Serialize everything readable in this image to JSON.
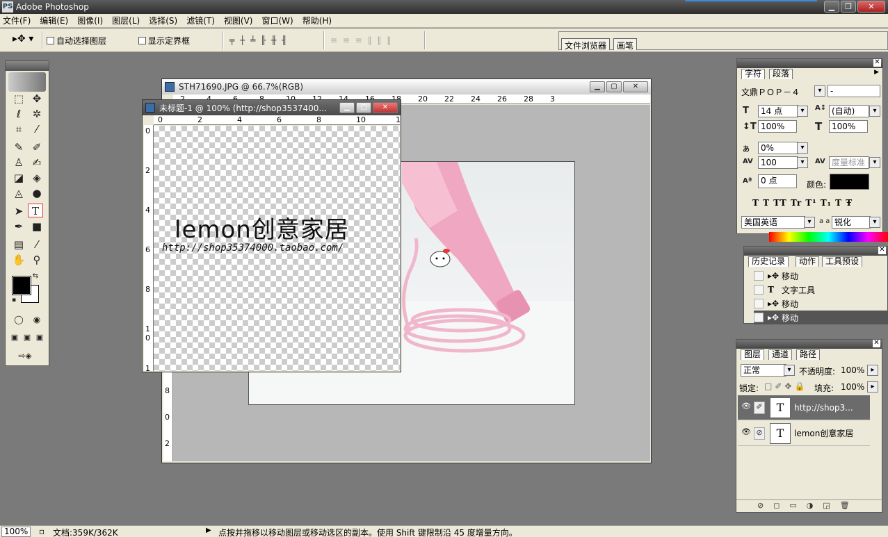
{
  "app": {
    "title": "Adobe Photoshop"
  },
  "menu": [
    "文件(F)",
    "编辑(E)",
    "图像(I)",
    "图层(L)",
    "选择(S)",
    "滤镜(T)",
    "视图(V)",
    "窗口(W)",
    "帮助(H)"
  ],
  "options": {
    "auto_select": "自动选择图层",
    "show_bounds": "显示定界框"
  },
  "well": {
    "tab1": "文件浏览器",
    "tab2": "画笔"
  },
  "doc_main": {
    "title": "STH71690.JPG @ 66.7%(RGB)",
    "h_ticks": [
      "2",
      "4",
      "6",
      "8",
      "10",
      "12",
      "14",
      "16",
      "18",
      "20",
      "22",
      "24",
      "26",
      "28",
      "3"
    ],
    "v_ticks": [
      "6",
      "8",
      "0",
      "2"
    ]
  },
  "doc_text": {
    "title": "未标题-1 @ 100% (http://shop3537400...",
    "h_ticks": [
      "0",
      "2",
      "4",
      "6",
      "8",
      "10",
      "1"
    ],
    "v_ticks": [
      "0",
      "2",
      "4",
      "6",
      "8",
      "1 0",
      "1"
    ],
    "headline": "lemon创意家居",
    "url": "http://shop35374000.taobao.com/"
  },
  "char_panel": {
    "tabs": [
      "字符",
      "段落"
    ],
    "font": "文鼎ＰＯＰ－４",
    "style": "-",
    "size": "14 点",
    "leading": "(自动)",
    "vscale": "100%",
    "hscale": "100%",
    "tsume": "0%",
    "tracking": "100",
    "kerning": "度量标准",
    "baseline": "0 点",
    "color_label": "颜色:",
    "language": "美国英语",
    "aa_label": "a a",
    "antialias": "锐化",
    "styles": "T T  TT Tr T¹ T₁  T Ŧ"
  },
  "history_panel": {
    "tabs": [
      "历史记录",
      "动作",
      "工具预设"
    ],
    "items": [
      "移动",
      "文字工具",
      "移动",
      "移动"
    ]
  },
  "layers_panel": {
    "tabs": [
      "图层",
      "通道",
      "路径"
    ],
    "blend": "正常",
    "opacity_label": "不透明度:",
    "opacity": "100%",
    "lock_label": "锁定:",
    "fill_label": "填充:",
    "fill": "100%",
    "layers": [
      "http://shop3...",
      "lemon创意家居"
    ]
  },
  "status": {
    "zoom": "100%",
    "doc_info": "文档:359K/362K",
    "hint": "点按并拖移以移动图层或移动选区的副本。使用 Shift 键限制沿 45 度增量方向。"
  }
}
